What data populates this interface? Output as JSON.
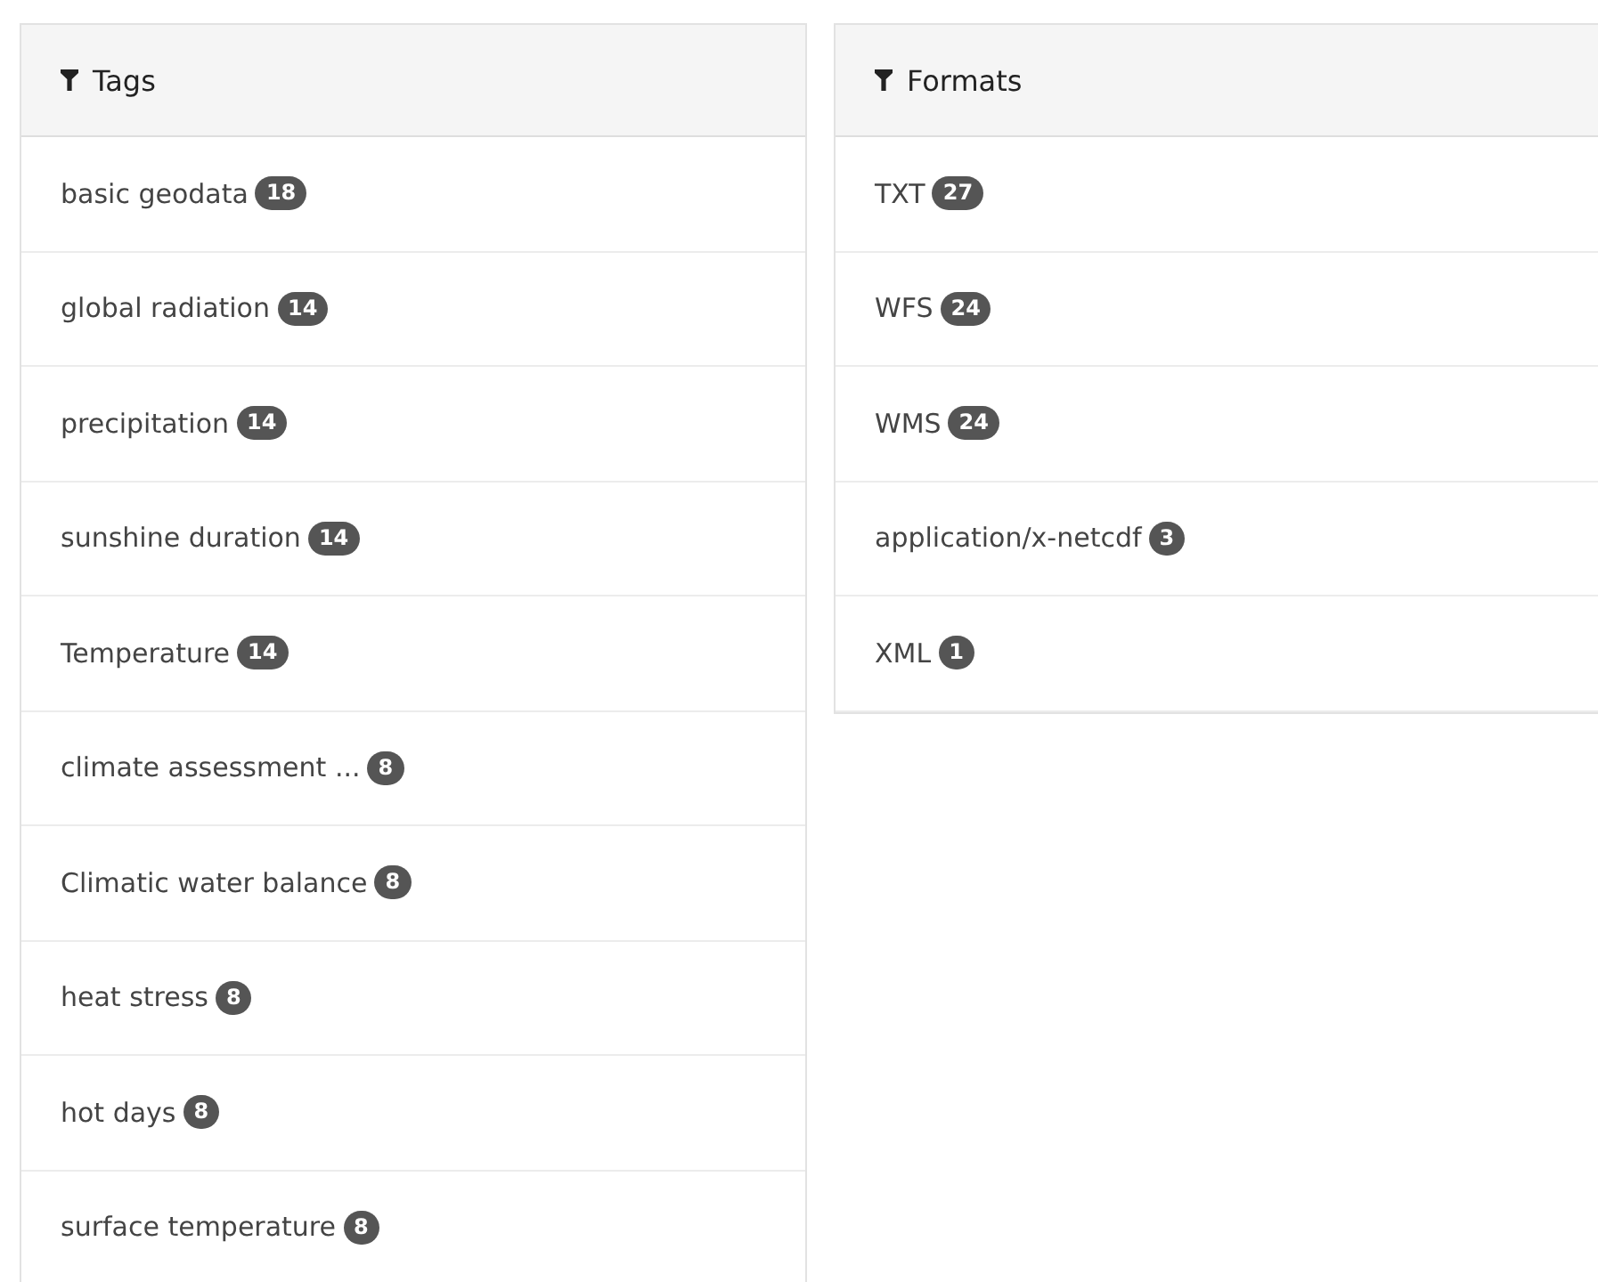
{
  "panels": [
    {
      "title": "Tags",
      "items": [
        {
          "label": "basic geodata",
          "count": "18"
        },
        {
          "label": "global radiation",
          "count": "14"
        },
        {
          "label": "precipitation",
          "count": "14"
        },
        {
          "label": "sunshine duration",
          "count": "14"
        },
        {
          "label": "Temperature",
          "count": "14"
        },
        {
          "label": "climate assessment ...",
          "count": "8"
        },
        {
          "label": "Climatic water balance",
          "count": "8"
        },
        {
          "label": "heat stress",
          "count": "8"
        },
        {
          "label": "hot days",
          "count": "8"
        },
        {
          "label": "surface temperature",
          "count": "8"
        }
      ]
    },
    {
      "title": "Formats",
      "items": [
        {
          "label": "TXT",
          "count": "27"
        },
        {
          "label": "WFS",
          "count": "24"
        },
        {
          "label": "WMS",
          "count": "24"
        },
        {
          "label": "application/x-netcdf",
          "count": "3"
        },
        {
          "label": "XML",
          "count": "1"
        }
      ]
    }
  ]
}
